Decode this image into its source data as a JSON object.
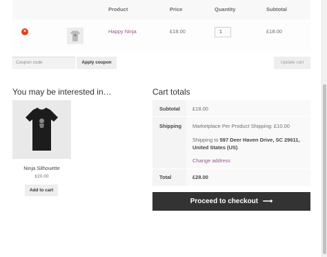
{
  "cart": {
    "headers": {
      "product": "Product",
      "price": "Price",
      "quantity": "Quantity",
      "subtotal": "Subtotal"
    },
    "rows": [
      {
        "remove": "×",
        "product_name": "Happy Ninja",
        "price": "£18.00",
        "quantity": "1",
        "subtotal": "£18.00"
      }
    ]
  },
  "coupon": {
    "placeholder": "Coupon code",
    "apply_label": "Apply coupon"
  },
  "update_cart_label": "Update cart",
  "related": {
    "heading": "You may be interested in…",
    "products": [
      {
        "name": "Ninja Silhouette",
        "price": "£20.00",
        "button": "Add to cart"
      }
    ]
  },
  "totals": {
    "heading": "Cart totals",
    "subtotal_label": "Subtotal",
    "subtotal_value": "£18.00",
    "shipping_label": "Shipping",
    "shipping_method": "Marketplace Per Product Shipping: £10.00",
    "shipping_to_prefix": "Shipping to",
    "shipping_address": "597 Deer Haven Drive, SC 29611, United States (US)",
    "change_address": "Change address",
    "total_label": "Total",
    "total_value": "£28.00"
  },
  "checkout": {
    "label": "Proceed to checkout",
    "arrow": "⟶"
  },
  "colors": {
    "link": "#96588a",
    "remove": "#e2401c",
    "checkout_bg": "#333333"
  }
}
